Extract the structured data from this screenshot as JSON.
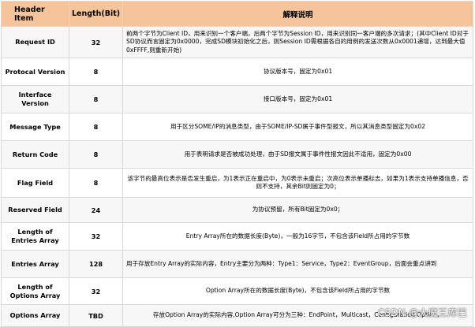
{
  "table": {
    "headers": [
      "Header Item",
      "Length(Bit)",
      "解释说明"
    ],
    "rows": [
      {
        "item": "Request ID",
        "length": "32",
        "desc": "前两个字节为Client ID，用来识别一个客户端，后两个字节为Session ID，用来识别同一客户端的多次请求；(其中Client ID对于SD协议而言固定为0x0000，完成SD模块初始化之后，则Session ID需根据各自的用例的发送次数从0x0001递增，达到最大值0xFFFF,则重新开始)"
      },
      {
        "item": "Protocal Version",
        "length": "8",
        "desc": "协议版本号，固定为0x01"
      },
      {
        "item": "Interface Version",
        "length": "8",
        "desc": "接口版本号，固定为0x01"
      },
      {
        "item": "Message Type",
        "length": "8",
        "desc": "用于区分SOME/IP的消息类型，由于SOME/IP-SD属于事件型报文，所以其消息类型固定为0x02"
      },
      {
        "item": "Return Code",
        "length": "8",
        "desc": "用于表明请求是否被成功处理，由于SD报文属于事件性报文因此不适用，固定为0x00"
      },
      {
        "item": "Flag Field",
        "length": "8",
        "desc": "该字节的最高位表示是否发生重启，为1表示正在重启中，为0表示未重启；次高位表示单播标志，如果为1表示支持单播信息，否则不支持，其余Bit则固定为0；"
      },
      {
        "item": "Reserved Field",
        "length": "24",
        "desc": "为协议预留，所有Bit固定为0x0；"
      },
      {
        "item": "Length of Entries Array",
        "length": "32",
        "desc": "Entry Array所在的数据长度(Byte)，一般为16字节，不包含该Field所占用的字节数"
      },
      {
        "item": "Entries Array",
        "length": "128",
        "desc": "用于存放Entry Array的实际内容，Entry主要分为两种：Type1：Service，Type2：EventGroup，后面会重点讲到"
      },
      {
        "item": "Length of Options Array",
        "length": "32",
        "desc": "Option Array所在的数据长度(Byte)，不包含该Field所占用的字节数"
      },
      {
        "item": "Options Array",
        "length": "TBD",
        "desc": "存放Option Array的实际内容,Option Array可分为三种：EndPoint，Multicast，Configuration Option，"
      }
    ]
  },
  "watermark": "CSDN @大魔王库巴"
}
